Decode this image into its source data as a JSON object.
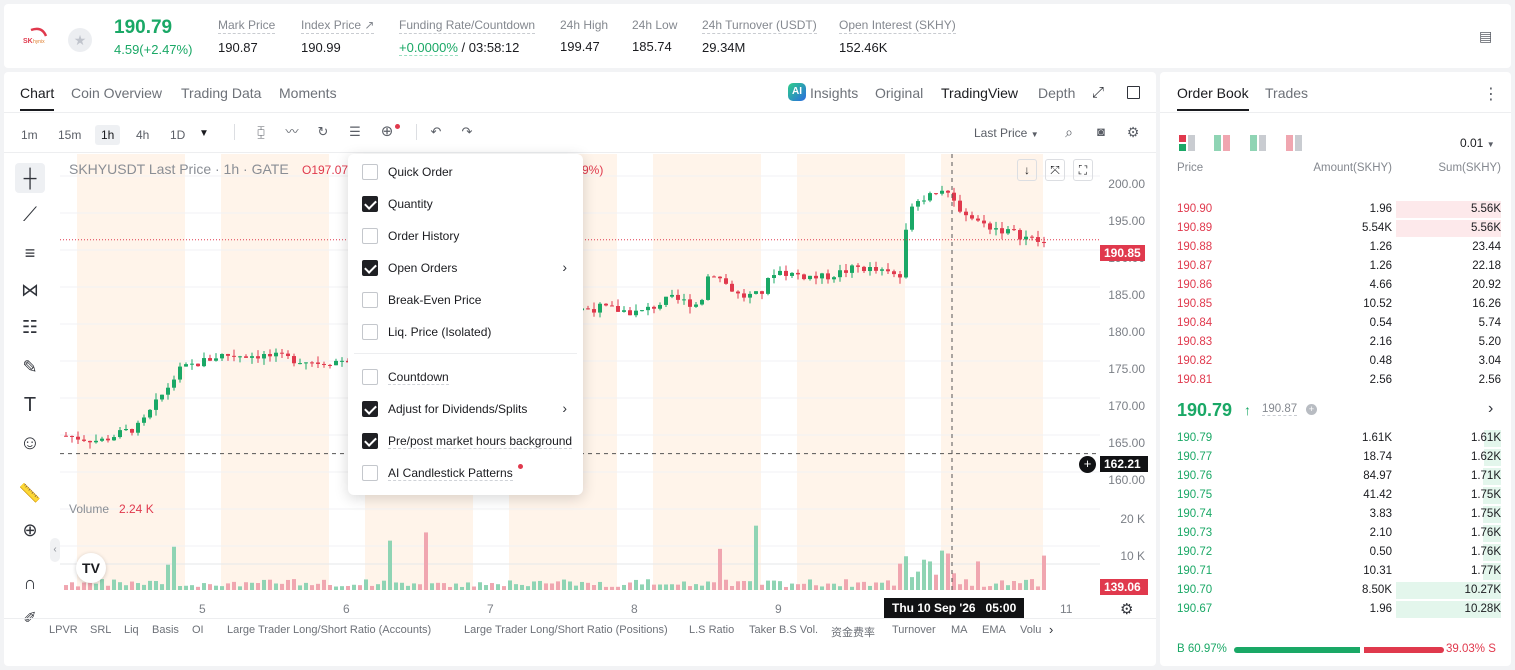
{
  "ticker": {
    "symbol_logo_text": "SK hynix",
    "last_price": "190.79",
    "change": "4.59(+2.47%)",
    "stats": [
      {
        "label": "Mark Price",
        "value": "190.87"
      },
      {
        "label": "Index Price ↗",
        "value": "190.99"
      },
      {
        "label": "Funding Rate/Countdown",
        "value_green": "+0.0000%",
        "value": "/ 03:58:12"
      },
      {
        "label": "24h High",
        "value": "199.47"
      },
      {
        "label": "24h Low",
        "value": "185.74"
      },
      {
        "label": "24h Turnover (USDT)",
        "value": "29.34M"
      },
      {
        "label": "Open Interest (SKHY)",
        "value": "152.46K"
      }
    ]
  },
  "chart_tabs": [
    "Chart",
    "Coin Overview",
    "Trading Data",
    "Moments"
  ],
  "view_tabs": {
    "insights": "Insights",
    "original": "Original",
    "tradingview": "TradingView",
    "depth": "Depth"
  },
  "timeframes": [
    "1m",
    "15m",
    "1h",
    "4h",
    "1D"
  ],
  "price_source": "Last Price",
  "chart_legend": {
    "title": "SKHYUSDT Last Price · 1h · GATE",
    "open": "O197.07",
    "pct": "9%)"
  },
  "volume_legend": {
    "label": "Volume",
    "value": "2.24 K"
  },
  "price_axis": [
    "200.00",
    "195.00",
    "190.00",
    "185.00",
    "180.00",
    "175.00",
    "170.00",
    "165.00",
    "160.00"
  ],
  "volume_axis": [
    "20 K",
    "10 K"
  ],
  "price_labels": {
    "current": "190.85",
    "crosshair": "162.21",
    "volume": "139.06"
  },
  "x_axis": [
    "5",
    "6",
    "7",
    "8",
    "9",
    "11"
  ],
  "crosshair_time": "Thu 10 Sep '26   05:00",
  "bottom_tabs": [
    "LPVR",
    "SRL",
    "Liq",
    "Basis",
    "OI",
    "Large Trader Long/Short Ratio (Accounts)",
    "Large Trader Long/Short Ratio (Positions)",
    "L.S Ratio",
    "Taker B.S Vol.",
    "资金费率",
    "Turnover",
    "MA",
    "EMA",
    "Volu"
  ],
  "settings_menu": [
    {
      "label": "Quick Order",
      "checked": false
    },
    {
      "label": "Quantity",
      "checked": true
    },
    {
      "label": "Order History",
      "checked": false
    },
    {
      "label": "Open Orders",
      "checked": true,
      "submenu": true
    },
    {
      "label": "Break-Even Price",
      "checked": false
    },
    {
      "label": "Liq. Price (Isolated)",
      "checked": false
    },
    {
      "label": "Countdown",
      "checked": false
    },
    {
      "label": "Adjust for Dividends/Splits",
      "checked": true,
      "submenu": true
    },
    {
      "label": "Pre/post market hours background",
      "checked": true
    },
    {
      "label": "AI Candlestick Patterns",
      "checked": false,
      "dot": true
    }
  ],
  "orderbook": {
    "tabs": [
      "Order Book",
      "Trades"
    ],
    "precision": "0.01",
    "headers": [
      "Price",
      "Amount(SKHY)",
      "Sum(SKHY)"
    ],
    "asks": [
      [
        "190.90",
        "1.96",
        "5.56K"
      ],
      [
        "190.89",
        "5.54K",
        "5.56K"
      ],
      [
        "190.88",
        "1.26",
        "23.44"
      ],
      [
        "190.87",
        "1.26",
        "22.18"
      ],
      [
        "190.86",
        "4.66",
        "20.92"
      ],
      [
        "190.85",
        "10.52",
        "16.26"
      ],
      [
        "190.84",
        "0.54",
        "5.74"
      ],
      [
        "190.83",
        "2.16",
        "5.20"
      ],
      [
        "190.82",
        "0.48",
        "3.04"
      ],
      [
        "190.81",
        "2.56",
        "2.56"
      ]
    ],
    "mid_price": "190.79",
    "mark_price": "190.87",
    "bids": [
      [
        "190.79",
        "1.61K",
        "1.61K"
      ],
      [
        "190.77",
        "18.74",
        "1.62K"
      ],
      [
        "190.76",
        "84.97",
        "1.71K"
      ],
      [
        "190.75",
        "41.42",
        "1.75K"
      ],
      [
        "190.74",
        "3.83",
        "1.75K"
      ],
      [
        "190.73",
        "2.10",
        "1.76K"
      ],
      [
        "190.72",
        "0.50",
        "1.76K"
      ],
      [
        "190.71",
        "10.31",
        "1.77K"
      ],
      [
        "190.70",
        "8.50K",
        "10.27K"
      ],
      [
        "190.67",
        "1.96",
        "10.28K"
      ]
    ],
    "ask_depth": [
      1.0,
      1.0,
      0.0,
      0.0,
      0.0,
      0.0,
      0.0,
      0.0,
      0.0,
      0.0
    ],
    "bid_depth": [
      0.16,
      0.16,
      0.17,
      0.17,
      0.17,
      0.17,
      0.17,
      0.17,
      1.0,
      1.0
    ],
    "buy_ratio": "B 60.97%",
    "sell_ratio": "39.03% S",
    "buy_fraction": 0.6097
  },
  "colors": {
    "up": "#1aa866",
    "down": "#e0394d",
    "up_soft": "#8fd4b4",
    "down_soft": "#f0a6b0",
    "session_bg": "#fff4ea"
  }
}
